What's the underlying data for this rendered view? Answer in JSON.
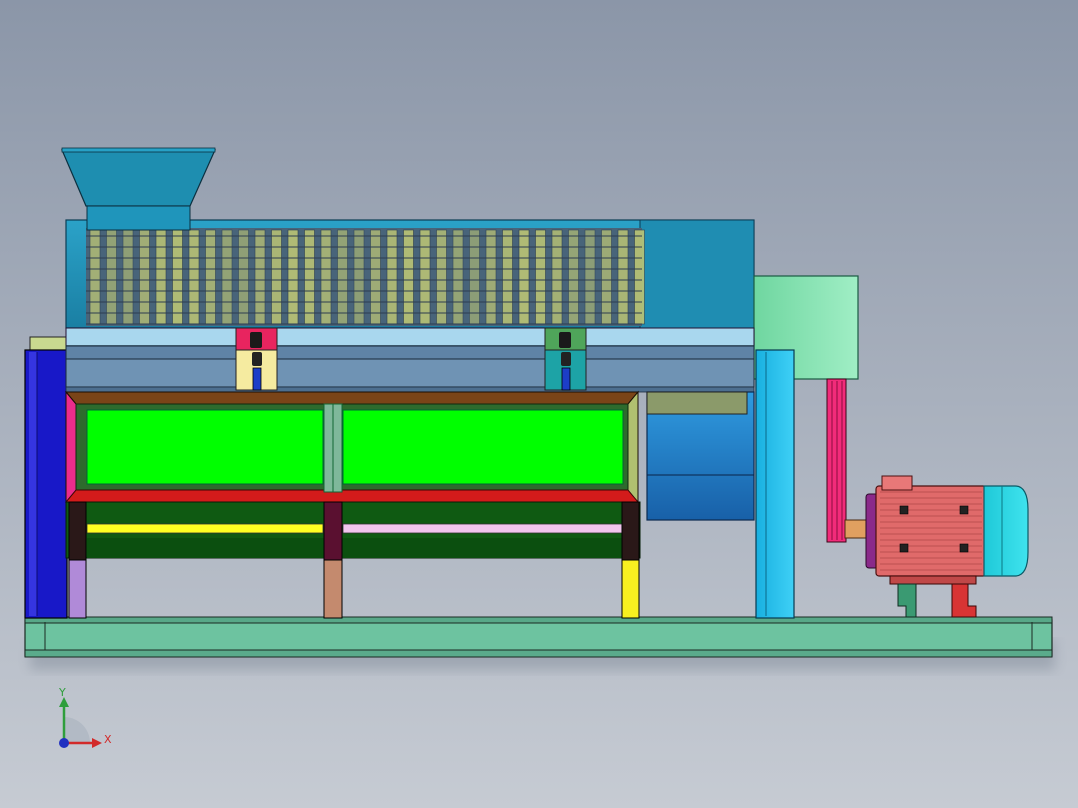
{
  "viewport": {
    "background_top": "#8b96a8",
    "background_bottom": "#c6cbd3"
  },
  "model": {
    "components": [
      "hopper",
      "screen-drum",
      "drum-end-cap",
      "upper-rail",
      "lower-rail",
      "bearing-block-left",
      "bearing-block-right",
      "left-end-plate",
      "right-support-post",
      "collection-frame",
      "screen-panel-left",
      "screen-panel-right",
      "side-chute",
      "v-belt-drive",
      "electric-motor",
      "motor-stand",
      "base-channel"
    ],
    "colors": {
      "hopper": "#1e8eb0",
      "drum": "#1e8cb0",
      "mesh_fill": "#bcc575",
      "rail_upper": "#a9d7ee",
      "rail_lower": "#6f93b4",
      "bearing_left_top": "#e8245f",
      "bearing_left_bottom": "#f5eba0",
      "bearing_right_top": "#4fa55a",
      "bearing_right_bottom": "#1da3a6",
      "end_plate": "#1818c8",
      "support_post": "#1ec3f0",
      "frame_top": "#7a4418",
      "frame_bottom_bar": "#d31b1b",
      "frame_side_left": "#ea2c8c",
      "screen_panel": "#00ff00",
      "chute": "#1a8bd6",
      "drum_end_cap": "#7fe0ad",
      "belt": "#f22b7a",
      "motor_body": "#e06a6a",
      "motor_fan_cover": "#27d6e4",
      "motor_flange": "#8a2a8a",
      "base": "#6dc3a0"
    }
  },
  "triad": {
    "x_label": "X",
    "y_label": "Y",
    "x_color": "#d22a2a",
    "y_color": "#2f9e3c",
    "z_color": "#2030c0"
  }
}
